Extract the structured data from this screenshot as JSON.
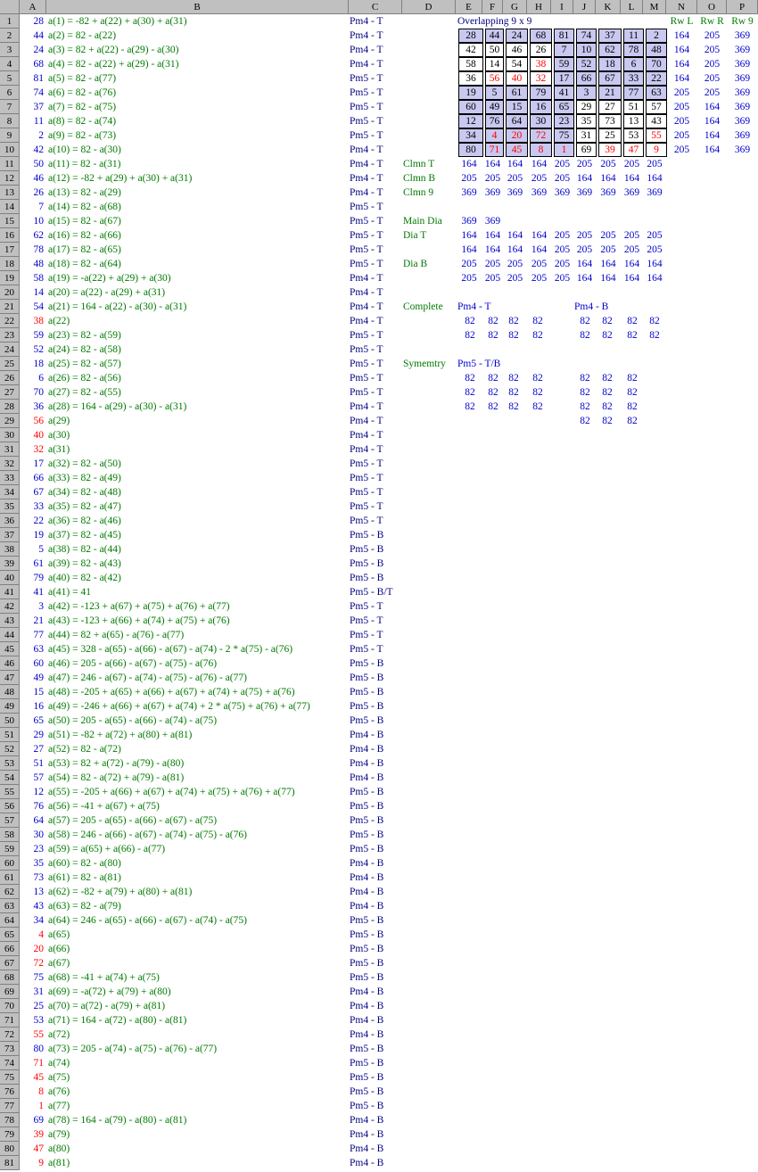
{
  "columns": [
    "A",
    "B",
    "C",
    "D",
    "E",
    "F",
    "G",
    "H",
    "I",
    "J",
    "K",
    "L",
    "M",
    "N",
    "O",
    "P"
  ],
  "rows": [
    {
      "n": 1,
      "a": "28",
      "ac": "blue",
      "b": "a(1) = -82 + a(22) + a(30) + a(31)",
      "c": "Pm4 - T"
    },
    {
      "n": 2,
      "a": "44",
      "ac": "blue",
      "b": "a(2) = 82 - a(22)",
      "c": "Pm4 - T"
    },
    {
      "n": 3,
      "a": "24",
      "ac": "blue",
      "b": "a(3) = 82 + a(22) - a(29) - a(30)",
      "c": "Pm4 - T"
    },
    {
      "n": 4,
      "a": "68",
      "ac": "blue",
      "b": "a(4) = 82 - a(22) + a(29) - a(31)",
      "c": "Pm4 - T"
    },
    {
      "n": 5,
      "a": "81",
      "ac": "blue",
      "b": "a(5) = 82 - a(77)",
      "c": "Pm5 - T"
    },
    {
      "n": 6,
      "a": "74",
      "ac": "blue",
      "b": "a(6) = 82 - a(76)",
      "c": "Pm5 - T"
    },
    {
      "n": 7,
      "a": "37",
      "ac": "blue",
      "b": "a(7) = 82 - a(75)",
      "c": "Pm5 - T"
    },
    {
      "n": 8,
      "a": "11",
      "ac": "blue",
      "b": "a(8) = 82 - a(74)",
      "c": "Pm5 - T"
    },
    {
      "n": 9,
      "a": "2",
      "ac": "blue",
      "b": "a(9) = 82 - a(73)",
      "c": "Pm5 - T"
    },
    {
      "n": 10,
      "a": "42",
      "ac": "blue",
      "b": "a(10) = 82 - a(30)",
      "c": "Pm4 - T"
    },
    {
      "n": 11,
      "a": "50",
      "ac": "blue",
      "b": "a(11) = 82 - a(31)",
      "c": "Pm4 - T"
    },
    {
      "n": 12,
      "a": "46",
      "ac": "blue",
      "b": "a(12) = -82 + a(29) + a(30) + a(31)",
      "c": "Pm4 - T"
    },
    {
      "n": 13,
      "a": "26",
      "ac": "blue",
      "b": "a(13) = 82 - a(29)",
      "c": "Pm4 - T"
    },
    {
      "n": 14,
      "a": "7",
      "ac": "blue",
      "b": "a(14) = 82 - a(68)",
      "c": "Pm5 - T"
    },
    {
      "n": 15,
      "a": "10",
      "ac": "blue",
      "b": "a(15) = 82 - a(67)",
      "c": "Pm5 - T"
    },
    {
      "n": 16,
      "a": "62",
      "ac": "blue",
      "b": "a(16) = 82 - a(66)",
      "c": "Pm5 - T"
    },
    {
      "n": 17,
      "a": "78",
      "ac": "blue",
      "b": "a(17) = 82 - a(65)",
      "c": "Pm5 - T"
    },
    {
      "n": 18,
      "a": "48",
      "ac": "blue",
      "b": "a(18) = 82 - a(64)",
      "c": "Pm5 - T"
    },
    {
      "n": 19,
      "a": "58",
      "ac": "blue",
      "b": "a(19) = -a(22) + a(29) + a(30)",
      "c": "Pm4 - T"
    },
    {
      "n": 20,
      "a": "14",
      "ac": "blue",
      "b": "a(20) = a(22) - a(29) + a(31)",
      "c": "Pm4 - T"
    },
    {
      "n": 21,
      "a": "54",
      "ac": "blue",
      "b": "a(21) = 164 - a(22) - a(30) - a(31)",
      "c": "Pm4 - T"
    },
    {
      "n": 22,
      "a": "38",
      "ac": "red",
      "b": "a(22)",
      "c": "Pm4 - T"
    },
    {
      "n": 23,
      "a": "59",
      "ac": "blue",
      "b": "a(23) = 82 - a(59)",
      "c": "Pm5 - T"
    },
    {
      "n": 24,
      "a": "52",
      "ac": "blue",
      "b": "a(24) = 82 - a(58)",
      "c": "Pm5 - T"
    },
    {
      "n": 25,
      "a": "18",
      "ac": "blue",
      "b": "a(25) = 82 - a(57)",
      "c": "Pm5 - T"
    },
    {
      "n": 26,
      "a": "6",
      "ac": "blue",
      "b": "a(26) = 82 - a(56)",
      "c": "Pm5 - T"
    },
    {
      "n": 27,
      "a": "70",
      "ac": "blue",
      "b": "a(27) = 82 - a(55)",
      "c": "Pm5 - T"
    },
    {
      "n": 28,
      "a": "36",
      "ac": "blue",
      "b": "a(28) = 164 - a(29) - a(30) - a(31)",
      "c": "Pm4 - T"
    },
    {
      "n": 29,
      "a": "56",
      "ac": "red",
      "b": "a(29)",
      "c": "Pm4 - T"
    },
    {
      "n": 30,
      "a": "40",
      "ac": "red",
      "b": "a(30)",
      "c": "Pm4 - T"
    },
    {
      "n": 31,
      "a": "32",
      "ac": "red",
      "b": "a(31)",
      "c": "Pm4 - T"
    },
    {
      "n": 32,
      "a": "17",
      "ac": "blue",
      "b": "a(32) = 82 - a(50)",
      "c": "Pm5 - T"
    },
    {
      "n": 33,
      "a": "66",
      "ac": "blue",
      "b": "a(33) = 82 - a(49)",
      "c": "Pm5 - T"
    },
    {
      "n": 34,
      "a": "67",
      "ac": "blue",
      "b": "a(34) = 82 - a(48)",
      "c": "Pm5 - T"
    },
    {
      "n": 35,
      "a": "33",
      "ac": "blue",
      "b": "a(35) = 82 - a(47)",
      "c": "Pm5 - T"
    },
    {
      "n": 36,
      "a": "22",
      "ac": "blue",
      "b": "a(36) = 82 - a(46)",
      "c": "Pm5 - T"
    },
    {
      "n": 37,
      "a": "19",
      "ac": "blue",
      "b": "a(37) = 82 - a(45)",
      "c": "Pm5 - B"
    },
    {
      "n": 38,
      "a": "5",
      "ac": "blue",
      "b": "a(38) = 82 - a(44)",
      "c": "Pm5 - B"
    },
    {
      "n": 39,
      "a": "61",
      "ac": "blue",
      "b": "a(39) = 82 - a(43)",
      "c": "Pm5 - B"
    },
    {
      "n": 40,
      "a": "79",
      "ac": "blue",
      "b": "a(40) = 82 - a(42)",
      "c": "Pm5 - B"
    },
    {
      "n": 41,
      "a": "41",
      "ac": "blue",
      "b": "a(41) = 41",
      "c": "Pm5 - B/T"
    },
    {
      "n": 42,
      "a": "3",
      "ac": "blue",
      "b": "a(42) = -123 + a(67) + a(75) + a(76) + a(77)",
      "c": "Pm5 - T"
    },
    {
      "n": 43,
      "a": "21",
      "ac": "blue",
      "b": "a(43) = -123 + a(66) + a(74) + a(75) + a(76)",
      "c": "Pm5 - T"
    },
    {
      "n": 44,
      "a": "77",
      "ac": "blue",
      "b": "a(44) = 82 + a(65) - a(76) - a(77)",
      "c": "Pm5 - T"
    },
    {
      "n": 45,
      "a": "63",
      "ac": "blue",
      "b": "a(45) = 328 - a(65) - a(66) - a(67) - a(74) - 2 * a(75) - a(76)",
      "c": "Pm5 - T"
    },
    {
      "n": 46,
      "a": "60",
      "ac": "blue",
      "b": "a(46) = 205 - a(66) - a(67) - a(75) - a(76)",
      "c": "Pm5 - B"
    },
    {
      "n": 47,
      "a": "49",
      "ac": "blue",
      "b": "a(47) = 246 - a(67) - a(74) - a(75) - a(76) - a(77)",
      "c": "Pm5 - B"
    },
    {
      "n": 48,
      "a": "15",
      "ac": "blue",
      "b": "a(48) = -205 + a(65) + a(66) + a(67) + a(74) + a(75) + a(76)",
      "c": "Pm5 - B"
    },
    {
      "n": 49,
      "a": "16",
      "ac": "blue",
      "b": "a(49) = -246 + a(66) + a(67) + a(74) + 2 * a(75) + a(76) + a(77)",
      "c": "Pm5 - B"
    },
    {
      "n": 50,
      "a": "65",
      "ac": "blue",
      "b": "a(50) = 205 - a(65) - a(66) - a(74) - a(75)",
      "c": "Pm5 - B"
    },
    {
      "n": 51,
      "a": "29",
      "ac": "blue",
      "b": "a(51) = -82 + a(72) + a(80) + a(81)",
      "c": "Pm4 - B"
    },
    {
      "n": 52,
      "a": "27",
      "ac": "blue",
      "b": "a(52) = 82 - a(72)",
      "c": "Pm4 - B"
    },
    {
      "n": 53,
      "a": "51",
      "ac": "blue",
      "b": "a(53) = 82 + a(72) - a(79) - a(80)",
      "c": "Pm4 - B"
    },
    {
      "n": 54,
      "a": "57",
      "ac": "blue",
      "b": "a(54) = 82 - a(72) + a(79) - a(81)",
      "c": "Pm4 - B"
    },
    {
      "n": 55,
      "a": "12",
      "ac": "blue",
      "b": "a(55) = -205 + a(66) + a(67) + a(74) + a(75) + a(76) + a(77)",
      "c": "Pm5 - B"
    },
    {
      "n": 56,
      "a": "76",
      "ac": "blue",
      "b": "a(56) = -41 + a(67) + a(75)",
      "c": "Pm5 - B"
    },
    {
      "n": 57,
      "a": "64",
      "ac": "blue",
      "b": "a(57) = 205 - a(65) - a(66) - a(67) - a(75)",
      "c": "Pm5 - B"
    },
    {
      "n": 58,
      "a": "30",
      "ac": "blue",
      "b": "a(58) = 246 - a(66) - a(67) - a(74) - a(75) - a(76)",
      "c": "Pm5 - B"
    },
    {
      "n": 59,
      "a": "23",
      "ac": "blue",
      "b": "a(59) = a(65) + a(66) - a(77)",
      "c": "Pm5 - B"
    },
    {
      "n": 60,
      "a": "35",
      "ac": "blue",
      "b": "a(60) = 82 - a(80)",
      "c": "Pm4 - B"
    },
    {
      "n": 61,
      "a": "73",
      "ac": "blue",
      "b": "a(61) = 82 - a(81)",
      "c": "Pm4 - B"
    },
    {
      "n": 62,
      "a": "13",
      "ac": "blue",
      "b": "a(62) = -82 + a(79) + a(80) + a(81)",
      "c": "Pm4 - B"
    },
    {
      "n": 63,
      "a": "43",
      "ac": "blue",
      "b": "a(63) = 82 - a(79)",
      "c": "Pm4 - B"
    },
    {
      "n": 64,
      "a": "34",
      "ac": "blue",
      "b": "a(64) = 246 - a(65) - a(66) - a(67) - a(74) - a(75)",
      "c": "Pm5 - B"
    },
    {
      "n": 65,
      "a": "4",
      "ac": "red",
      "b": "a(65)",
      "c": "Pm5 - B"
    },
    {
      "n": 66,
      "a": "20",
      "ac": "red",
      "b": "a(66)",
      "c": "Pm5 - B"
    },
    {
      "n": 67,
      "a": "72",
      "ac": "red",
      "b": "a(67)",
      "c": "Pm5 - B"
    },
    {
      "n": 68,
      "a": "75",
      "ac": "blue",
      "b": "a(68) = -41 + a(74) + a(75)",
      "c": "Pm5 - B"
    },
    {
      "n": 69,
      "a": "31",
      "ac": "blue",
      "b": "a(69) = -a(72) + a(79) + a(80)",
      "c": "Pm4 - B"
    },
    {
      "n": 70,
      "a": "25",
      "ac": "blue",
      "b": "a(70) = a(72) - a(79) + a(81)",
      "c": "Pm4 - B"
    },
    {
      "n": 71,
      "a": "53",
      "ac": "blue",
      "b": "a(71) = 164 - a(72) - a(80) - a(81)",
      "c": "Pm4 - B"
    },
    {
      "n": 72,
      "a": "55",
      "ac": "red",
      "b": "a(72)",
      "c": "Pm4 - B"
    },
    {
      "n": 73,
      "a": "80",
      "ac": "blue",
      "b": "a(73) = 205 - a(74) - a(75) - a(76) - a(77)",
      "c": "Pm5 - B"
    },
    {
      "n": 74,
      "a": "71",
      "ac": "red",
      "b": "a(74)",
      "c": "Pm5 - B"
    },
    {
      "n": 75,
      "a": "45",
      "ac": "red",
      "b": "a(75)",
      "c": "Pm5 - B"
    },
    {
      "n": 76,
      "a": "8",
      "ac": "red",
      "b": "a(76)",
      "c": "Pm5 - B"
    },
    {
      "n": 77,
      "a": "1",
      "ac": "red",
      "b": "a(77)",
      "c": "Pm5 - B"
    },
    {
      "n": 78,
      "a": "69",
      "ac": "blue",
      "b": "a(78) = 164 - a(79) - a(80) - a(81)",
      "c": "Pm4 - B"
    },
    {
      "n": 79,
      "a": "39",
      "ac": "red",
      "b": "a(79)",
      "c": "Pm4 - B"
    },
    {
      "n": 80,
      "a": "47",
      "ac": "red",
      "b": "a(80)",
      "c": "Pm4 - B"
    },
    {
      "n": 81,
      "a": "9",
      "ac": "red",
      "b": "a(81)",
      "c": "Pm4 - B"
    }
  ],
  "square": {
    "title": "Overlapping 9 x 9",
    "values": [
      [
        28,
        44,
        24,
        68,
        81,
        74,
        37,
        11,
        2
      ],
      [
        42,
        50,
        46,
        26,
        7,
        10,
        62,
        78,
        48
      ],
      [
        58,
        14,
        54,
        38,
        59,
        52,
        18,
        6,
        70
      ],
      [
        36,
        56,
        40,
        32,
        17,
        66,
        67,
        33,
        22
      ],
      [
        19,
        5,
        61,
        79,
        41,
        3,
        21,
        77,
        63
      ],
      [
        60,
        49,
        15,
        16,
        65,
        29,
        27,
        51,
        57
      ],
      [
        12,
        76,
        64,
        30,
        23,
        35,
        73,
        13,
        43
      ],
      [
        34,
        4,
        20,
        72,
        75,
        31,
        25,
        53,
        55
      ],
      [
        80,
        71,
        45,
        8,
        1,
        69,
        39,
        47,
        9
      ]
    ],
    "red": [
      [
        3,
        1
      ],
      [
        3,
        2
      ],
      [
        3,
        3
      ],
      [
        2,
        3
      ],
      [
        7,
        1
      ],
      [
        7,
        2
      ],
      [
        7,
        3
      ],
      [
        8,
        1
      ],
      [
        8,
        2
      ],
      [
        8,
        3
      ],
      [
        8,
        4
      ],
      [
        7,
        8
      ],
      [
        8,
        6
      ],
      [
        8,
        7
      ],
      [
        8,
        8
      ]
    ],
    "shaded": [
      [
        0,
        0
      ],
      [
        0,
        1
      ],
      [
        0,
        2
      ],
      [
        0,
        3
      ],
      [
        0,
        4
      ],
      [
        0,
        5
      ],
      [
        0,
        6
      ],
      [
        0,
        7
      ],
      [
        0,
        8
      ],
      [
        1,
        4
      ],
      [
        1,
        5
      ],
      [
        1,
        6
      ],
      [
        1,
        7
      ],
      [
        1,
        8
      ],
      [
        2,
        4
      ],
      [
        2,
        5
      ],
      [
        2,
        6
      ],
      [
        2,
        7
      ],
      [
        2,
        8
      ],
      [
        3,
        4
      ],
      [
        3,
        5
      ],
      [
        3,
        6
      ],
      [
        3,
        7
      ],
      [
        3,
        8
      ],
      [
        4,
        0
      ],
      [
        4,
        1
      ],
      [
        4,
        2
      ],
      [
        4,
        3
      ],
      [
        4,
        4
      ],
      [
        4,
        5
      ],
      [
        4,
        6
      ],
      [
        4,
        7
      ],
      [
        4,
        8
      ],
      [
        5,
        0
      ],
      [
        5,
        1
      ],
      [
        5,
        2
      ],
      [
        5,
        3
      ],
      [
        5,
        4
      ],
      [
        6,
        0
      ],
      [
        6,
        1
      ],
      [
        6,
        2
      ],
      [
        6,
        3
      ],
      [
        6,
        4
      ],
      [
        7,
        0
      ],
      [
        7,
        1
      ],
      [
        7,
        2
      ],
      [
        7,
        3
      ],
      [
        7,
        4
      ],
      [
        8,
        0
      ],
      [
        8,
        1
      ],
      [
        8,
        2
      ],
      [
        8,
        3
      ],
      [
        8,
        4
      ]
    ]
  },
  "row_sum_headers": [
    "Rw L",
    "Rw R",
    "Rw 9"
  ],
  "row_sums": [
    [
      164,
      205,
      369
    ],
    [
      164,
      205,
      369
    ],
    [
      164,
      205,
      369
    ],
    [
      164,
      205,
      369
    ],
    [
      205,
      205,
      369
    ],
    [
      205,
      164,
      369
    ],
    [
      205,
      164,
      369
    ],
    [
      205,
      164,
      369
    ],
    [
      205,
      164,
      369
    ]
  ],
  "col_rows": [
    {
      "label": "Clmn T",
      "values": [
        164,
        164,
        164,
        164,
        205,
        205,
        205,
        205,
        205
      ]
    },
    {
      "label": "Clmn B",
      "values": [
        205,
        205,
        205,
        205,
        205,
        164,
        164,
        164,
        164
      ]
    },
    {
      "label": "Clmn 9",
      "values": [
        369,
        369,
        369,
        369,
        369,
        369,
        369,
        369,
        369
      ]
    }
  ],
  "main_dia": {
    "label": "Main Dia",
    "values": [
      369,
      369
    ]
  },
  "dia_rows": [
    {
      "label": "Dia T",
      "values": [
        164,
        164,
        164,
        164,
        205,
        205,
        205,
        205,
        205
      ]
    },
    {
      "label": "",
      "values": [
        164,
        164,
        164,
        164,
        205,
        205,
        205,
        205,
        205
      ]
    },
    {
      "label": "Dia B",
      "values": [
        205,
        205,
        205,
        205,
        205,
        164,
        164,
        164,
        164
      ]
    },
    {
      "label": "",
      "values": [
        205,
        205,
        205,
        205,
        205,
        164,
        164,
        164,
        164
      ]
    }
  ],
  "complete": {
    "label": "Complete",
    "left_title": "Pm4 - T",
    "right_title": "Pm4 - B",
    "left": [
      [
        82,
        82,
        82,
        82
      ],
      [
        82,
        82,
        82,
        82
      ]
    ],
    "right": [
      [
        82,
        82,
        82,
        82
      ],
      [
        82,
        82,
        82,
        82
      ]
    ]
  },
  "symmetry": {
    "label": "Symemtry",
    "title": "Pm5 - T/B",
    "left": [
      [
        82,
        82,
        82,
        82
      ],
      [
        82,
        82,
        82,
        82
      ],
      [
        82,
        82,
        82,
        82
      ]
    ],
    "right": [
      [
        82,
        82,
        82
      ],
      [
        82,
        82,
        82
      ],
      [
        82,
        82,
        82
      ],
      [
        82,
        82,
        82
      ]
    ]
  }
}
